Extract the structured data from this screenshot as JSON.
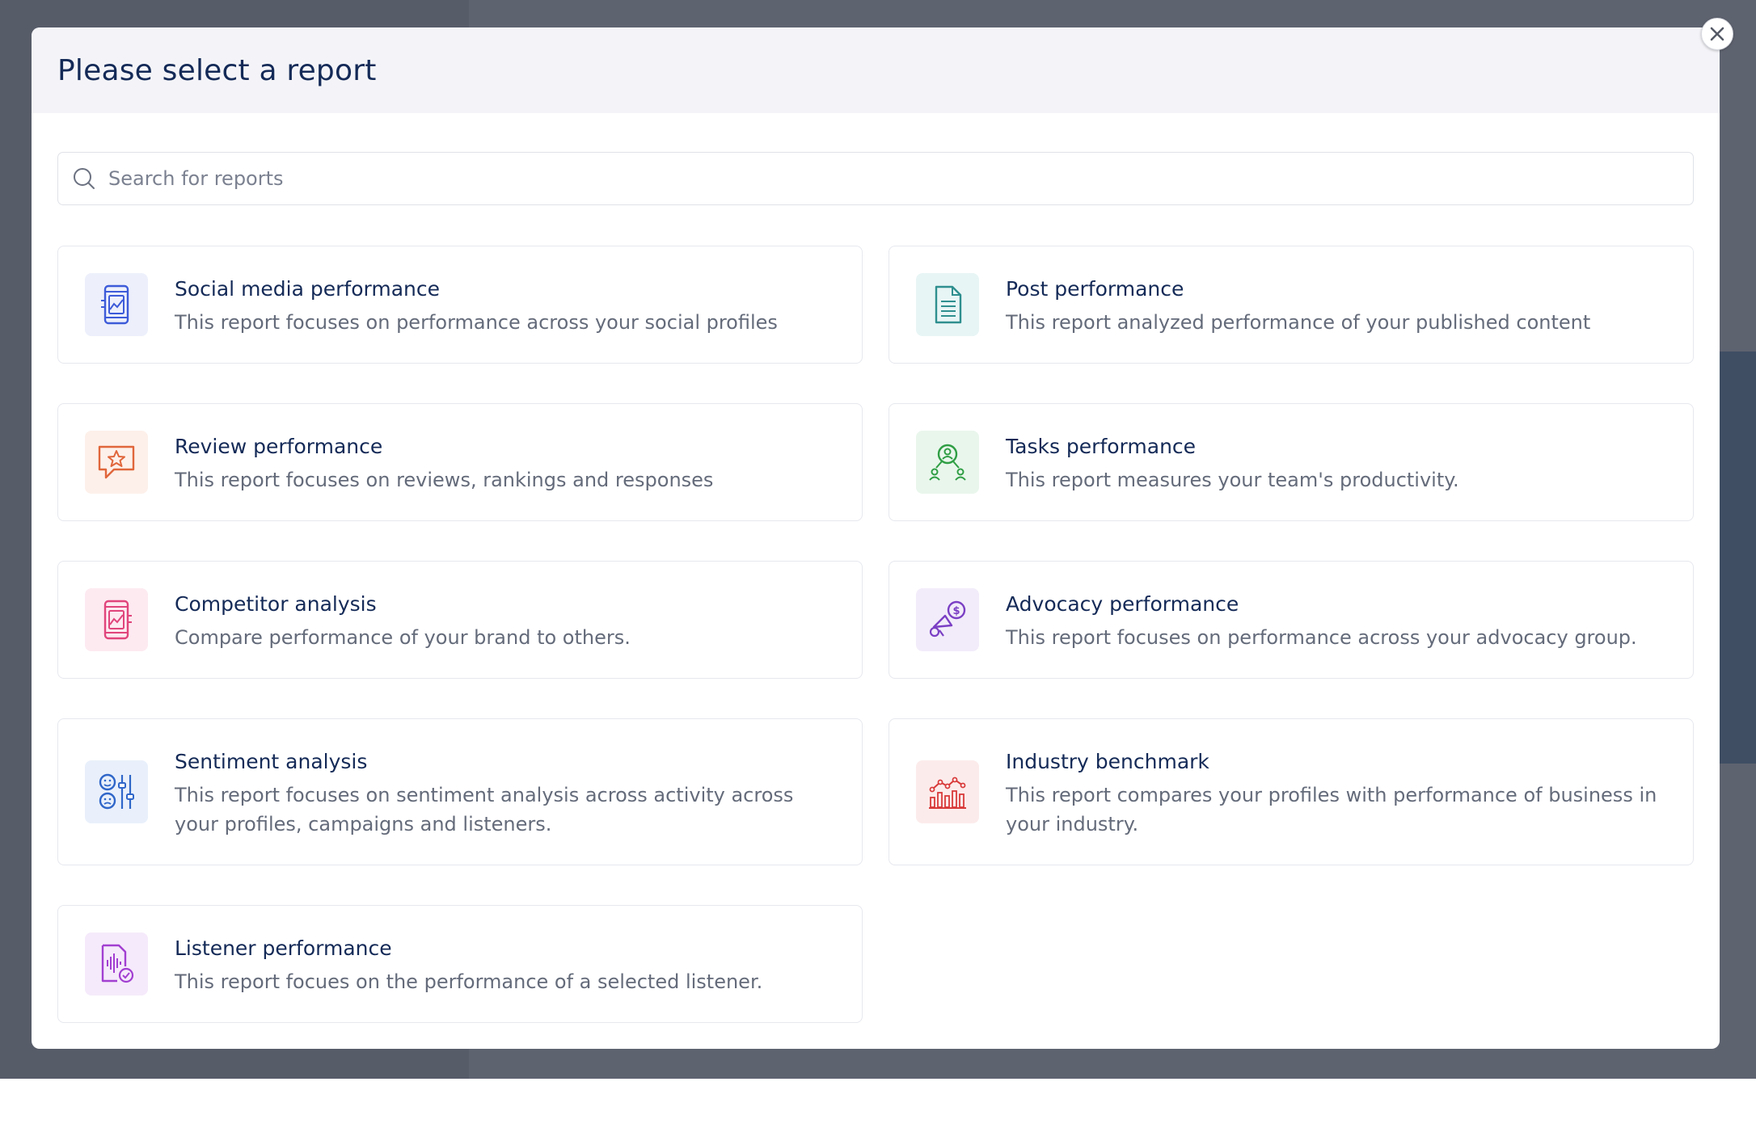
{
  "modal": {
    "title": "Please select a report",
    "close_icon": "close-icon"
  },
  "search": {
    "placeholder": "Search for reports",
    "value": ""
  },
  "reports": [
    {
      "title": "Social media performance",
      "description": "This report focuses on performance across your social profiles",
      "icon": "phone-chart-icon",
      "icon_color": "#3d5bd9",
      "icon_bg": "#edf0fb"
    },
    {
      "title": "Post performance",
      "description": "This report analyzed performance of your published content",
      "icon": "document-icon",
      "icon_color": "#2f8f8f",
      "icon_bg": "#e8f5f5"
    },
    {
      "title": "Review performance",
      "description": "This report focuses on reviews, rankings and responses",
      "icon": "star-message-icon",
      "icon_color": "#e0663b",
      "icon_bg": "#fdf0ea"
    },
    {
      "title": "Tasks performance",
      "description": "This report measures your team's productivity.",
      "icon": "team-icon",
      "icon_color": "#2f9e44",
      "icon_bg": "#e9f6ec"
    },
    {
      "title": "Competitor analysis",
      "description": "Compare performance of your brand to others.",
      "icon": "tablet-chart-icon",
      "icon_color": "#e0457b",
      "icon_bg": "#fdeaf1"
    },
    {
      "title": "Advocacy performance",
      "description": "This report focuses on performance across your advocacy group.",
      "icon": "megaphone-dollar-icon",
      "icon_color": "#7b3fc4",
      "icon_bg": "#f2ecfa"
    },
    {
      "title": "Sentiment analysis",
      "description": "This report focuses on sentiment analysis across activity across your profiles, campaigns and listeners.",
      "icon": "sentiment-icon",
      "icon_color": "#2f66c9",
      "icon_bg": "#e9f0fb"
    },
    {
      "title": "Industry benchmark",
      "description": "This report compares your profiles with performance of business in your industry.",
      "icon": "bar-chart-icon",
      "icon_color": "#d93a3a",
      "icon_bg": "#fcebeb"
    },
    {
      "title": "Listener performance",
      "description": "This report focues on the performance of a selected listener.",
      "icon": "audio-file-check-icon",
      "icon_color": "#a23fd1",
      "icon_bg": "#f5eafb"
    }
  ]
}
